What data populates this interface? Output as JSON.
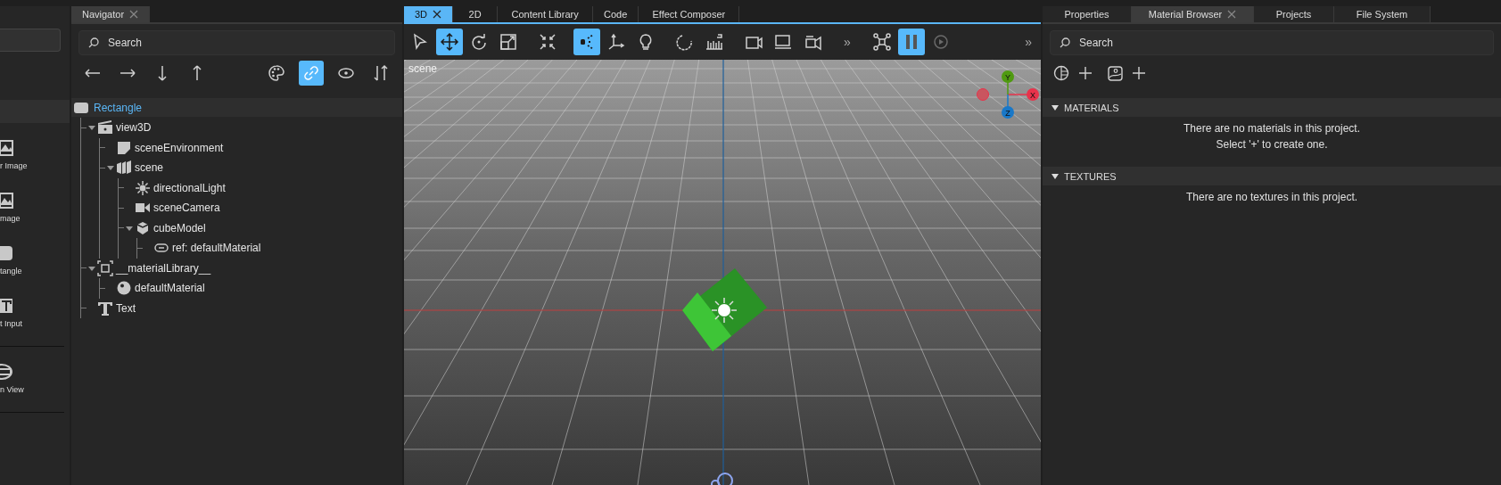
{
  "library_panel": {
    "items": [
      {
        "kind": "frame-image",
        "label": "r Image"
      },
      {
        "kind": "image",
        "label": "mage"
      },
      {
        "kind": "rectangle",
        "label": "tangle"
      },
      {
        "kind": "text-input",
        "label": "t Input"
      },
      {
        "kind": "list-view",
        "label": "n View"
      }
    ]
  },
  "navigator": {
    "tab": {
      "label": "Navigator",
      "selected": true
    },
    "search": {
      "placeholder": "Search"
    },
    "filters": [
      {
        "on": false
      },
      {
        "on": true
      },
      {
        "on": false
      },
      {
        "on": false
      }
    ],
    "root": {
      "label": "Rectangle",
      "selected": true
    },
    "tree": [
      {
        "kind": "view3d",
        "label": "view3D",
        "expanded": true,
        "children": [
          {
            "kind": "environment",
            "label": "sceneEnvironment",
            "expanded": false
          },
          {
            "kind": "scene",
            "label": "scene",
            "expanded": true,
            "children": [
              {
                "kind": "light",
                "label": "directionalLight",
                "expanded": false
              },
              {
                "kind": "camera",
                "label": "sceneCamera",
                "expanded": false
              },
              {
                "kind": "model",
                "label": "cubeModel",
                "expanded": true,
                "children": [
                  {
                    "kind": "reference",
                    "label": "ref: defaultMaterial",
                    "expanded": false
                  }
                ]
              }
            ]
          }
        ]
      },
      {
        "kind": "library",
        "label": "__materialLibrary__",
        "expanded": true,
        "children": [
          {
            "kind": "material",
            "label": "defaultMaterial",
            "expanded": false
          }
        ]
      },
      {
        "kind": "text",
        "label": "Text",
        "expanded": false
      }
    ]
  },
  "editor": {
    "tabs": [
      {
        "label": "3D",
        "selected": true,
        "closable": true
      },
      {
        "label": "2D",
        "selected": false,
        "closable": false
      },
      {
        "label": "Content Library",
        "selected": false,
        "closable": false
      },
      {
        "label": "Code",
        "selected": false,
        "closable": false
      },
      {
        "label": "Effect Composer",
        "selected": false,
        "closable": false
      }
    ],
    "tool_groups": [
      [
        {
          "kind": "button",
          "on": false,
          "disabled": false
        },
        {
          "kind": "button",
          "on": true,
          "disabled": false
        },
        {
          "kind": "button",
          "on": false,
          "disabled": false
        },
        {
          "kind": "button",
          "on": false,
          "disabled": false
        }
      ],
      [
        {
          "kind": "button",
          "on": false,
          "disabled": false
        }
      ],
      [
        {
          "kind": "button",
          "on": true,
          "disabled": false
        },
        {
          "kind": "button",
          "on": false,
          "disabled": false
        },
        {
          "kind": "button",
          "on": false,
          "disabled": false
        }
      ],
      [
        {
          "kind": "button",
          "on": false,
          "disabled": false
        },
        {
          "kind": "button",
          "on": false,
          "disabled": false
        }
      ],
      [
        {
          "kind": "button",
          "on": false,
          "disabled": false
        },
        {
          "kind": "button",
          "on": false,
          "disabled": false
        },
        {
          "kind": "button",
          "on": false,
          "disabled": false
        }
      ],
      [
        {
          "kind": "overflow",
          "label": "»"
        }
      ],
      [
        {
          "kind": "button",
          "on": false,
          "disabled": false
        },
        {
          "kind": "button",
          "on": true,
          "disabled": false
        },
        {
          "kind": "button",
          "on": false,
          "disabled": true
        }
      ]
    ],
    "end_overflow": "»",
    "viewport": {
      "label": "scene",
      "gizmo_axes": [
        "Y",
        "X",
        "Z"
      ]
    }
  },
  "right_panel": {
    "tabs": [
      {
        "label": "Properties",
        "selected": false,
        "closable": false
      },
      {
        "label": "Material Browser",
        "selected": true,
        "closable": true
      },
      {
        "label": "Projects",
        "selected": false,
        "closable": false
      },
      {
        "label": "File System",
        "selected": false,
        "closable": false
      }
    ],
    "search": {
      "placeholder": "Search"
    },
    "sections": [
      {
        "title": "MATERIALS",
        "expanded": true,
        "messages": [
          "There are no materials in this project.",
          "Select '+' to create one."
        ]
      },
      {
        "title": "TEXTURES",
        "expanded": true,
        "messages": [
          "There are no textures in this project."
        ]
      }
    ]
  }
}
